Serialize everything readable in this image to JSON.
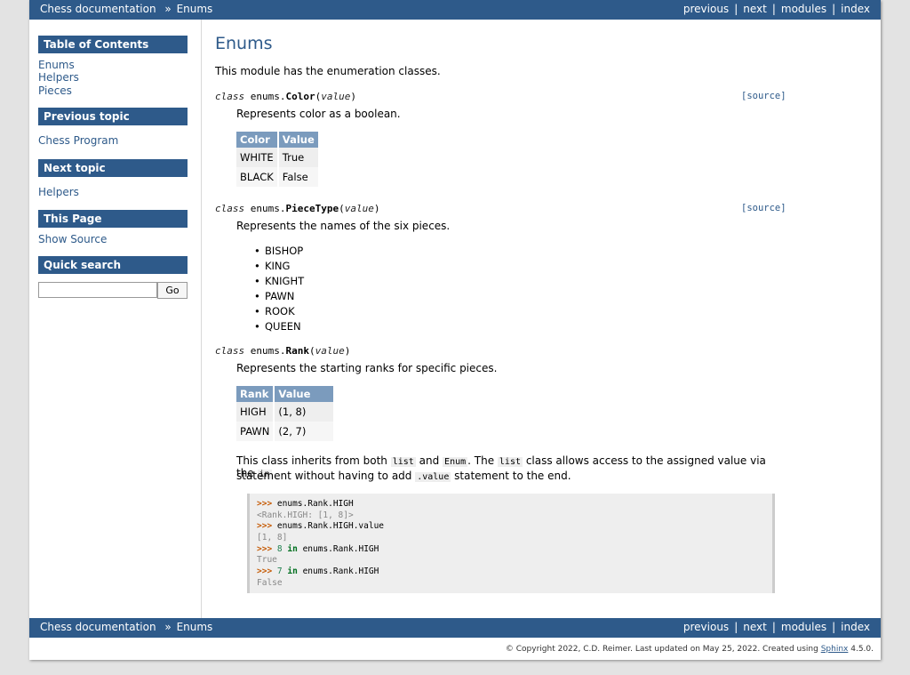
{
  "nav": {
    "breadcrumb_root": "Chess documentation",
    "breadcrumb_sep": "»",
    "breadcrumb_current": "Enums",
    "previous": "previous",
    "next": "next",
    "modules": "modules",
    "index": "index",
    "divider": "|"
  },
  "sidebar": {
    "toc_title": "Table of Contents",
    "toc_items": [
      "Enums",
      "Helpers",
      "Pieces"
    ],
    "prev_title": "Previous topic",
    "prev_link": "Chess Program",
    "next_title": "Next topic",
    "next_link": "Helpers",
    "this_page_title": "This Page",
    "show_source": "Show Source",
    "search_title": "Quick search",
    "search_value": "",
    "go_label": "Go"
  },
  "main": {
    "title": "Enums",
    "intro": "This module has the enumeration classes.",
    "color": {
      "kw": "class",
      "prefix": "enums.",
      "name": "Color",
      "param": "value",
      "source": "[source]",
      "desc": "Represents color as a boolean.",
      "headers": [
        "Color",
        "Value"
      ],
      "rows": [
        [
          "WHITE",
          "True"
        ],
        [
          "BLACK",
          "False"
        ]
      ]
    },
    "piecetype": {
      "kw": "class",
      "prefix": "enums.",
      "name": "PieceType",
      "param": "value",
      "source": "[source]",
      "desc": "Represents the names of the six pieces.",
      "items": [
        "BISHOP",
        "KING",
        "KNIGHT",
        "PAWN",
        "ROOK",
        "QUEEN"
      ]
    },
    "rank": {
      "kw": "class",
      "prefix": "enums.",
      "name": "Rank",
      "param": "value",
      "desc": "Represents the starting ranks for specific pieces.",
      "headers": [
        "Rank",
        "Value"
      ],
      "rows": [
        [
          "HIGH",
          "(1, 8)"
        ],
        [
          "PAWN",
          "(2, 7)"
        ]
      ],
      "inherit_p1": "This class inherits from both ",
      "inherit_c1": "list",
      "inherit_p2": " and ",
      "inherit_c2": "Enum",
      "inherit_p3": ". The ",
      "inherit_c3": "list",
      "inherit_p4": " class allows access to the assigned value via the ",
      "inherit_c4": "in",
      "inherit_p5": "statement without having to add ",
      "inherit_c5": ".value",
      "inherit_p6": " statement to the end."
    },
    "code": {
      "prompt": ">>>",
      "l1": "enums.Rank.HIGH",
      "o1": "<Rank.HIGH: [1, 8]>",
      "l2": "enums.Rank.HIGH.value",
      "o2": "[1, 8]",
      "l3_num": "8",
      "l3_kw": "in",
      "l3_rest": "enums.Rank.HIGH",
      "o3": "True",
      "l4_num": "7",
      "l4_kw": "in",
      "l4_rest": "enums.Rank.HIGH",
      "o4": "False"
    }
  },
  "footer": {
    "text": "© Copyright 2022, C.D. Reimer. Last updated on May 25, 2022. Created using ",
    "link": "Sphinx",
    "version": " 4.5.0."
  }
}
